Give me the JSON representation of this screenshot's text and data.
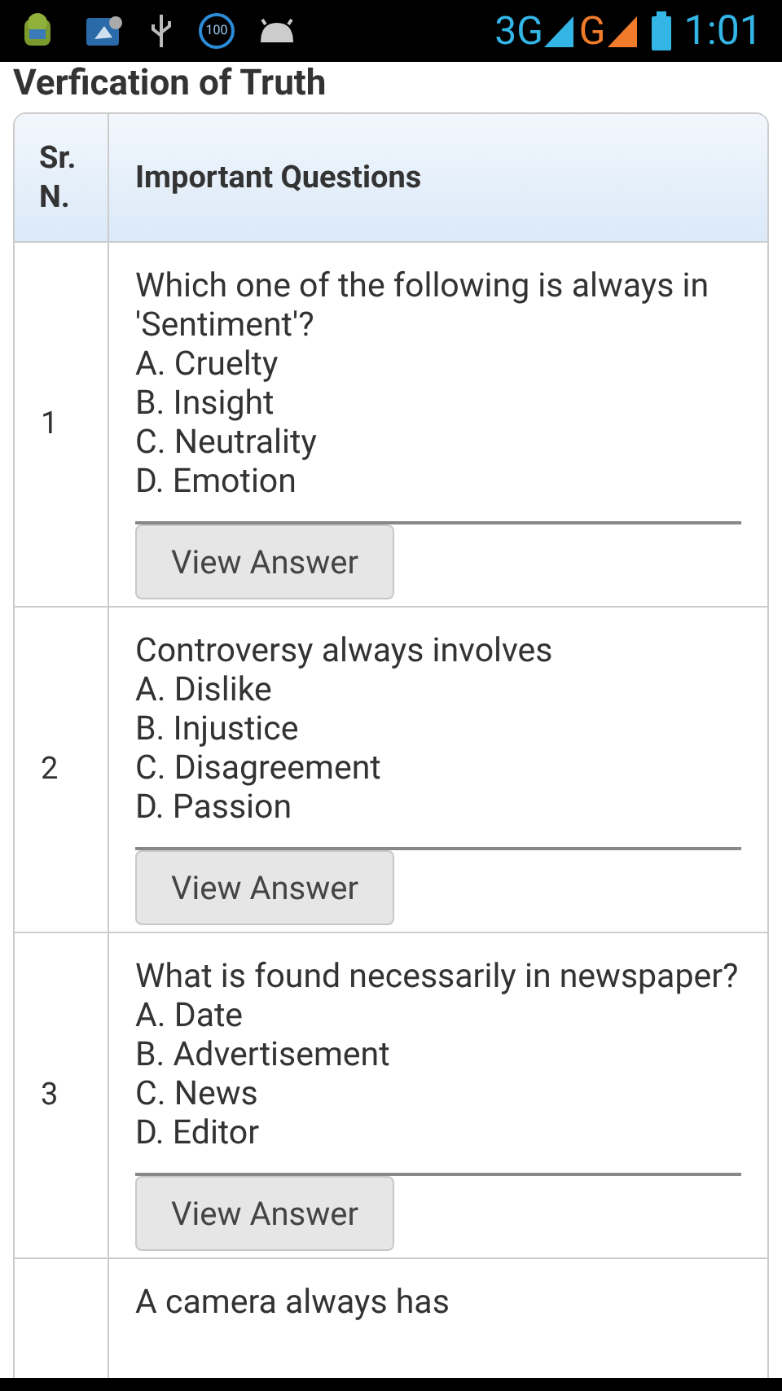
{
  "status_bar": {
    "badge": "100",
    "network_1": "3G",
    "network_2": "G",
    "time": "1:01"
  },
  "title": "Verfication of Truth",
  "table": {
    "columns": [
      "Sr. N.",
      "Important Questions"
    ],
    "rows": [
      {
        "number": "1",
        "question": "Which one of the following is always in 'Sentiment'?",
        "options": [
          "A. Cruelty",
          "B. Insight",
          "C. Neutrality",
          "D. Emotion"
        ],
        "button": "View Answer"
      },
      {
        "number": "2",
        "question": "Controversy always involves",
        "options": [
          "A. Dislike",
          "B. Injustice",
          "C. Disagreement",
          "D. Passion"
        ],
        "button": "View Answer"
      },
      {
        "number": "3",
        "question": "What is found necessarily in newspaper?",
        "options": [
          "A. Date",
          "B. Advertisement",
          "C. News",
          "D. Editor"
        ],
        "button": "View Answer"
      },
      {
        "question": "A camera always has"
      }
    ]
  }
}
